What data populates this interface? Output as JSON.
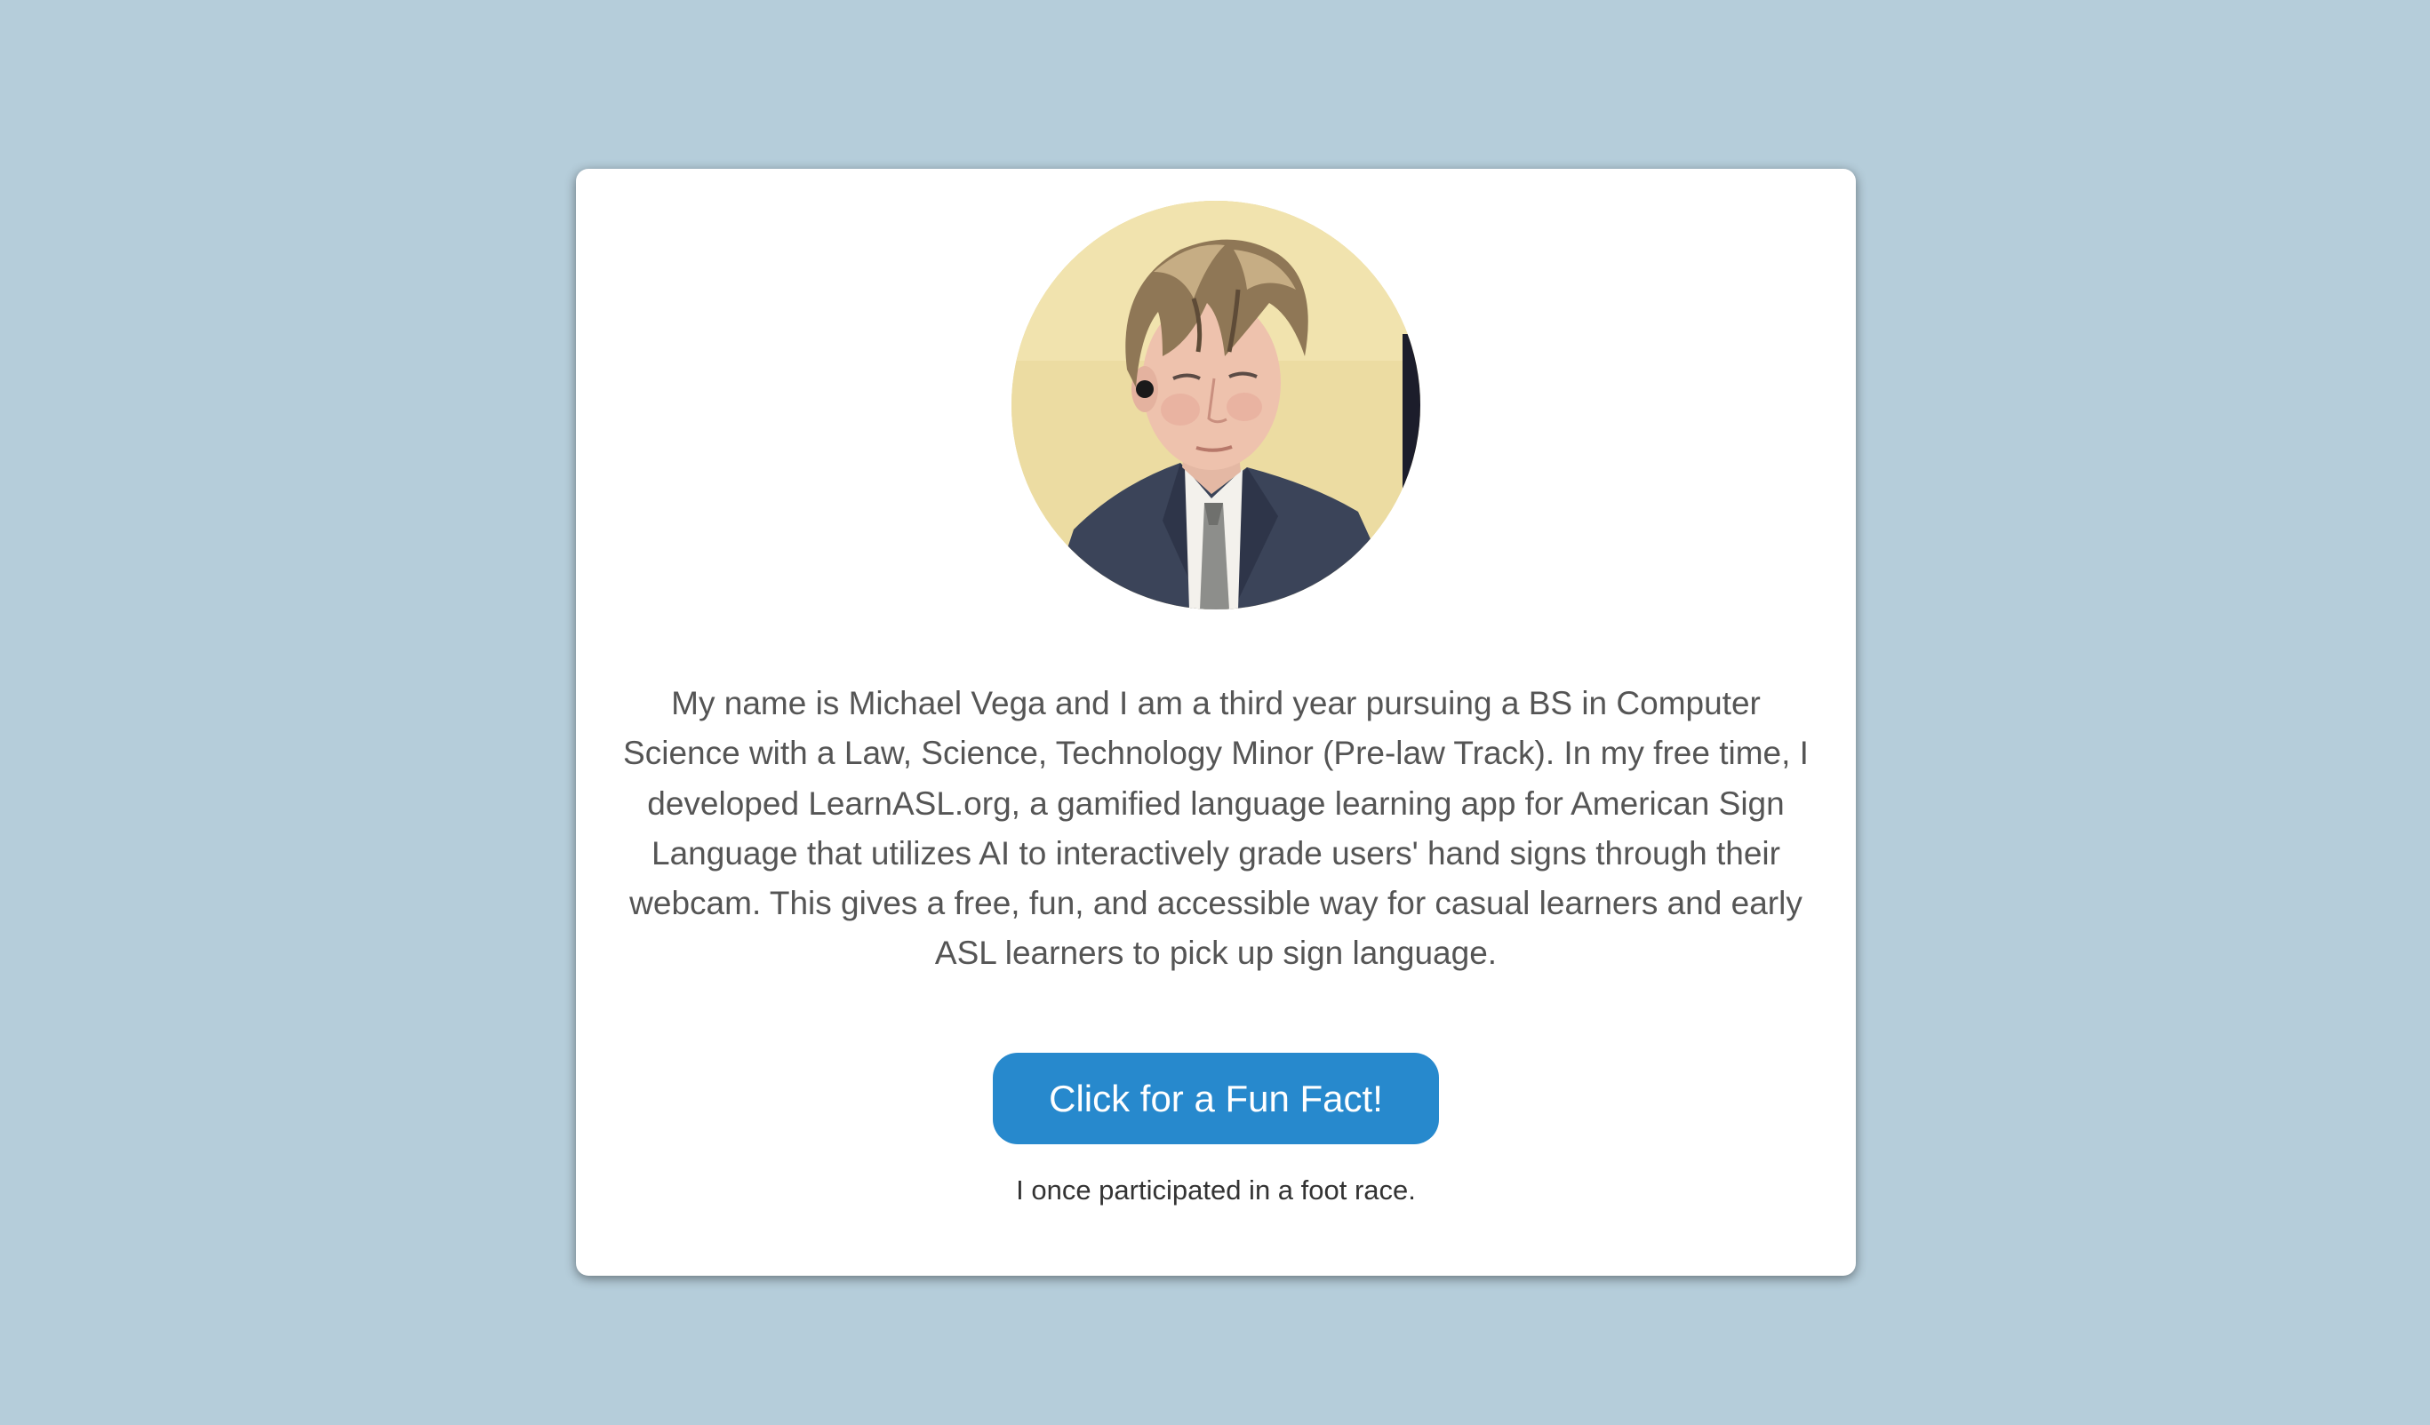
{
  "profile": {
    "photo_alt": "Michael Vega",
    "bio": "My name is Michael Vega and I am a third year pursuing a BS in Computer Science with a Law, Science, Technology Minor (Pre-law Track). In my free time, I developed LearnASL.org, a gamified language learning app for American Sign Language that utilizes AI to interactively grade users' hand signs through their webcam. This gives a free, fun, and accessible way for casual learners and early ASL learners to pick up sign language.",
    "fun_fact_button_label": "Click for a Fun Fact!",
    "fun_fact_text": "I once participated in a foot race."
  },
  "colors": {
    "page_background": "#b5cdda",
    "card_background": "#ffffff",
    "button_background": "#2789cd",
    "button_text": "#ffffff",
    "bio_text": "#555555",
    "fact_text": "#333333"
  }
}
